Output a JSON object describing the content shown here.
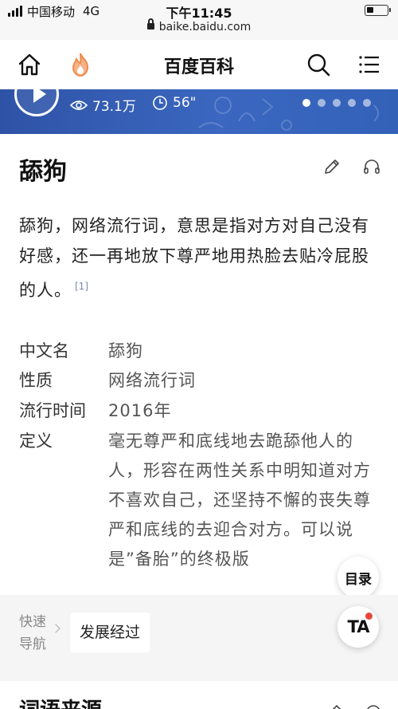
{
  "status_bar": {
    "carrier": "中国移动",
    "network": "4G",
    "time": "下午11:45",
    "url": "baike.baidu.com",
    "battery_level_fraction": 0.18
  },
  "navbar": {
    "title": "百度百科",
    "icons": [
      "home-icon",
      "flame-icon",
      "search-icon",
      "menu-icon"
    ]
  },
  "banner": {
    "views": "73.1万",
    "duration": "56\"",
    "carousel_dots": 5,
    "active_dot": 1
  },
  "entry": {
    "title": "舔狗",
    "summary": "舔狗，网络流行词，意思是指对方对自己没有好感，还一再地放下尊严地用热脸去贴冷屁股的人。",
    "citation": "[1]",
    "info": [
      {
        "label": "中文名",
        "value": "舔狗"
      },
      {
        "label": "性质",
        "value": "网络流行词"
      },
      {
        "label": "流行时间",
        "value": "2016年"
      },
      {
        "label": "定义",
        "value": "毫无尊严和底线地去跪舔他人的人，形容在两性关系中明知道对方不喜欢自己，还坚持不懈的丧失尊严和底线的去迎合对方。可以说是”备胎”的终极版"
      }
    ]
  },
  "floating": {
    "toc_label": "目录",
    "ta_label": "TA"
  },
  "quick_nav": {
    "label": "快速导航",
    "chip": "发展经过"
  },
  "next_section": {
    "title": "词语来源"
  },
  "colors": {
    "banner": "#3361b8",
    "accent_flame": "#f08a4b",
    "badge_red": "#e8473e"
  }
}
